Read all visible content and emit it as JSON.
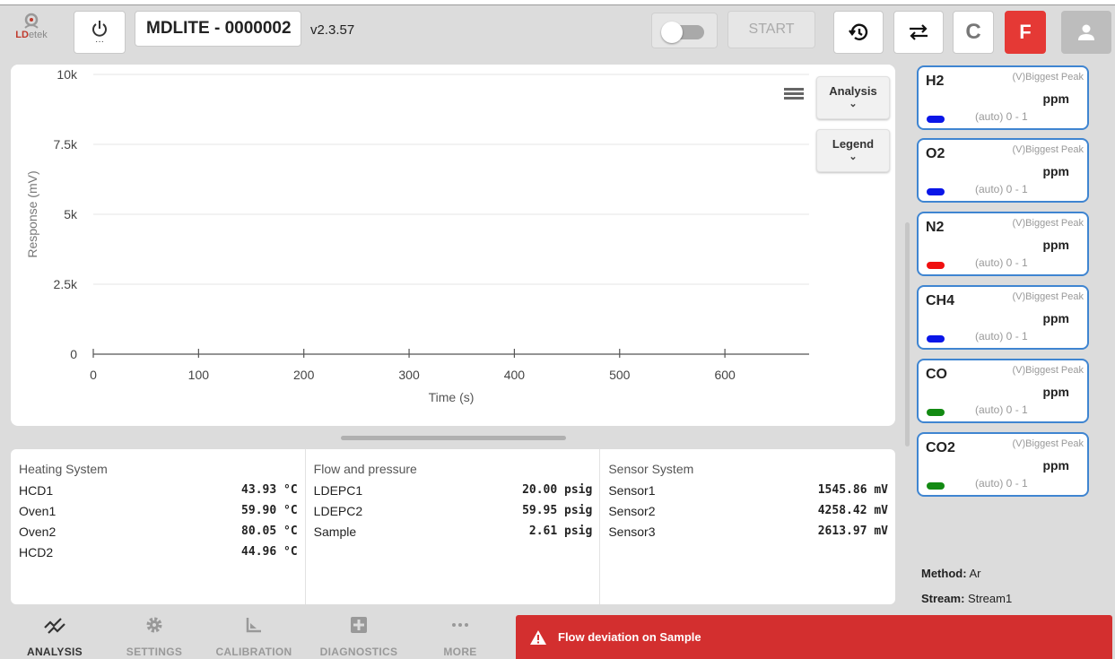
{
  "header": {
    "logo_text_accent": "LD",
    "logo_text_rest": "etek",
    "device_name": "MDLITE - 0000002",
    "version": "v2.3.57",
    "start_label": "START",
    "c_label": "C",
    "f_label": "F"
  },
  "chart_panel": {
    "analysis_label": "Analysis",
    "legend_label": "Legend"
  },
  "chart_data": {
    "type": "line",
    "xlabel": "Time (s)",
    "ylabel": "Response (mV)",
    "x_ticks": [
      "0",
      "100",
      "200",
      "300",
      "400",
      "500",
      "600"
    ],
    "y_ticks": [
      "0",
      "2.5k",
      "5k",
      "7.5k",
      "10k"
    ],
    "xlim": [
      0,
      680
    ],
    "ylim": [
      0,
      10000
    ],
    "grid": true,
    "series": []
  },
  "status": {
    "columns": [
      {
        "title": "Heating System",
        "rows": [
          {
            "label": "HCD1",
            "value": "43.93 °C"
          },
          {
            "label": "Oven1",
            "value": "59.90 °C"
          },
          {
            "label": "Oven2",
            "value": "80.05 °C"
          },
          {
            "label": "HCD2",
            "value": "44.96 °C"
          }
        ]
      },
      {
        "title": "Flow and pressure",
        "rows": [
          {
            "label": "LDEPC1",
            "value": "20.00 psig"
          },
          {
            "label": "LDEPC2",
            "value": "59.95 psig"
          },
          {
            "label": "Sample",
            "value": "2.61 psig"
          }
        ]
      },
      {
        "title": "Sensor System",
        "rows": [
          {
            "label": "Sensor1",
            "value": "1545.86 mV"
          },
          {
            "label": "Sensor2",
            "value": "4258.42 mV"
          },
          {
            "label": "Sensor3",
            "value": "2613.97 mV"
          }
        ]
      }
    ]
  },
  "gases": [
    {
      "name": "H2",
      "peak": "(V)Biggest Peak",
      "unit": "ppm",
      "range": "(auto) 0 - 1",
      "color": "#0a16e8"
    },
    {
      "name": "O2",
      "peak": "(V)Biggest Peak",
      "unit": "ppm",
      "range": "(auto) 0 - 1",
      "color": "#0a16e8"
    },
    {
      "name": "N2",
      "peak": "(V)Biggest Peak",
      "unit": "ppm",
      "range": "(auto) 0 - 1",
      "color": "#f01010"
    },
    {
      "name": "CH4",
      "peak": "(V)Biggest Peak",
      "unit": "ppm",
      "range": "(auto) 0 - 1",
      "color": "#0a16e8"
    },
    {
      "name": "CO",
      "peak": "(V)Biggest Peak",
      "unit": "ppm",
      "range": "(auto) 0 - 1",
      "color": "#138a13"
    },
    {
      "name": "CO2",
      "peak": "(V)Biggest Peak",
      "unit": "ppm",
      "range": "(auto) 0 - 1",
      "color": "#138a13"
    }
  ],
  "info": {
    "method_label": "Method:",
    "method_value": "Ar",
    "stream_label": "Stream:",
    "stream_value": "Stream1"
  },
  "nav": {
    "items": [
      {
        "label": "ANALYSIS",
        "icon": "analysis-icon"
      },
      {
        "label": "SETTINGS",
        "icon": "gear-icon"
      },
      {
        "label": "CALIBRATION",
        "icon": "calibration-icon"
      },
      {
        "label": "DIAGNOSTICS",
        "icon": "plus-box-icon"
      },
      {
        "label": "MORE",
        "icon": "more-icon"
      }
    ]
  },
  "alert": {
    "message": "Flow deviation on Sample",
    "color": "#d32f2f"
  }
}
